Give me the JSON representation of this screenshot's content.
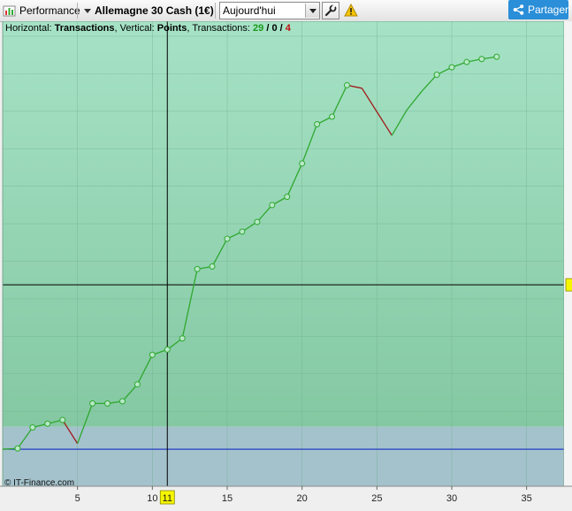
{
  "toolbar": {
    "performance_label": "Performance",
    "instrument": "Allemagne 30 Cash (1€)",
    "period": "Aujourd'hui",
    "share_label": "Partager",
    "icons": [
      "chart-icon",
      "dropdown-arrow-icon",
      "wrench-icon",
      "warning-icon",
      "share-icon"
    ]
  },
  "header": {
    "horizontal_label": "Horizontal: ",
    "horizontal_value": "Transactions",
    "vertical_label": ", Vertical: ",
    "vertical_value": "Points",
    "transactions_label": ", Transactions: ",
    "wins": "29",
    "sep1": " / ",
    "neutral": "0",
    "sep2": " / ",
    "losses": "4"
  },
  "copyright": "© IT-Finance.com",
  "colors": {
    "above_zero_fill": "#90d8b2",
    "below_zero_fill": "#a4c2cc",
    "gain_line": "#2ea82e",
    "loss_line": "#a01818",
    "zero_line": "#1020d0",
    "crosshair": "#000000",
    "cursor_label_bg": "#f6f600"
  },
  "chart_data": {
    "type": "line",
    "xlabel": "",
    "ylabel": "",
    "x_ticks": [
      5,
      10,
      15,
      20,
      25,
      30,
      35
    ],
    "xlim": [
      0,
      37.5
    ],
    "crosshair_x_label": "11",
    "grid": true,
    "x": [
      0,
      1,
      2,
      3,
      4,
      5,
      6,
      7,
      8,
      9,
      10,
      11,
      12,
      13,
      14,
      15,
      16,
      17,
      18,
      19,
      20,
      21,
      22,
      23,
      24,
      26,
      27,
      28,
      29,
      30,
      31,
      32,
      33
    ],
    "y": [
      0,
      0.2,
      5.8,
      6.8,
      7.8,
      1.5,
      12.2,
      12.2,
      12.8,
      17.3,
      25.2,
      26.6,
      29.6,
      48.1,
      48.8,
      56.2,
      58.1,
      60.7,
      65.2,
      67.4,
      76.3,
      86.8,
      88.8,
      97.2,
      96.4,
      83.8,
      90.6,
      95.6,
      100.0,
      102.0,
      103.4,
      104.2,
      104.8
    ],
    "markers": [
      false,
      true,
      true,
      true,
      true,
      false,
      true,
      true,
      true,
      true,
      true,
      true,
      true,
      true,
      true,
      true,
      true,
      true,
      true,
      true,
      true,
      true,
      true,
      true,
      false,
      false,
      false,
      false,
      true,
      true,
      true,
      true,
      true
    ],
    "losing_segments_end_index": [
      5,
      24,
      25
    ],
    "ylim": [
      -9.9,
      114.3
    ],
    "zero_value": 0,
    "crosshair_y_value": 43.9
  }
}
